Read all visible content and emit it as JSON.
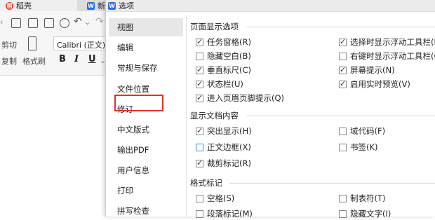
{
  "background_app": {
    "tab_doc_label": "稻壳",
    "tab_new_label": "新",
    "toolbar": {
      "cut_label": "剪切",
      "copy_label": "复制",
      "format_painter_label": "格式刷",
      "font_name": "Calibri (正文)",
      "bold": "B",
      "italic": "I",
      "underline": "U"
    }
  },
  "dialog": {
    "title": "选项",
    "nav_items": [
      {
        "label": "视图"
      },
      {
        "label": "编辑"
      },
      {
        "label": "常规与保存"
      },
      {
        "label": "文件位置"
      },
      {
        "label": "修订"
      },
      {
        "label": "中文版式"
      },
      {
        "label": "输出PDF"
      },
      {
        "label": "用户信息"
      },
      {
        "label": "打印"
      },
      {
        "label": "拼写检查"
      }
    ],
    "groups": {
      "page_display": {
        "title": "页面显示选项",
        "left": [
          {
            "label": "任务窗格(R)",
            "checked": true
          },
          {
            "label": "隐藏空白(B)",
            "checked": false
          },
          {
            "label": "垂直标尺(C)",
            "checked": true
          },
          {
            "label": "状态栏(U)",
            "checked": true
          },
          {
            "label": "进入页眉页脚提示(Q)",
            "checked": true
          }
        ],
        "right": [
          {
            "label": "选择时显示浮动工具栏(D)",
            "checked": true
          },
          {
            "label": "右键时显示浮动工具栏(G)",
            "checked": false
          },
          {
            "label": "屏幕提示(N)",
            "checked": true
          },
          {
            "label": "启用实时预览(V)",
            "checked": true
          }
        ]
      },
      "doc_content": {
        "title": "显示文档内容",
        "left": [
          {
            "label": "突出显示(H)",
            "checked": true
          },
          {
            "label": "正文边框(X)",
            "checked": false
          },
          {
            "label": "裁剪标记(R)",
            "checked": true
          }
        ],
        "right": [
          {
            "label": "域代码(F)",
            "checked": false
          },
          {
            "label": "书签(K)",
            "checked": false
          }
        ]
      },
      "format_marks": {
        "title": "格式标记",
        "left": [
          {
            "label": "空格(S)",
            "checked": false
          },
          {
            "label": "段落标记(M)",
            "checked": false
          }
        ],
        "right": [
          {
            "label": "制表符(T)",
            "checked": false
          },
          {
            "label": "隐藏文字(I)",
            "checked": false
          }
        ]
      }
    }
  }
}
